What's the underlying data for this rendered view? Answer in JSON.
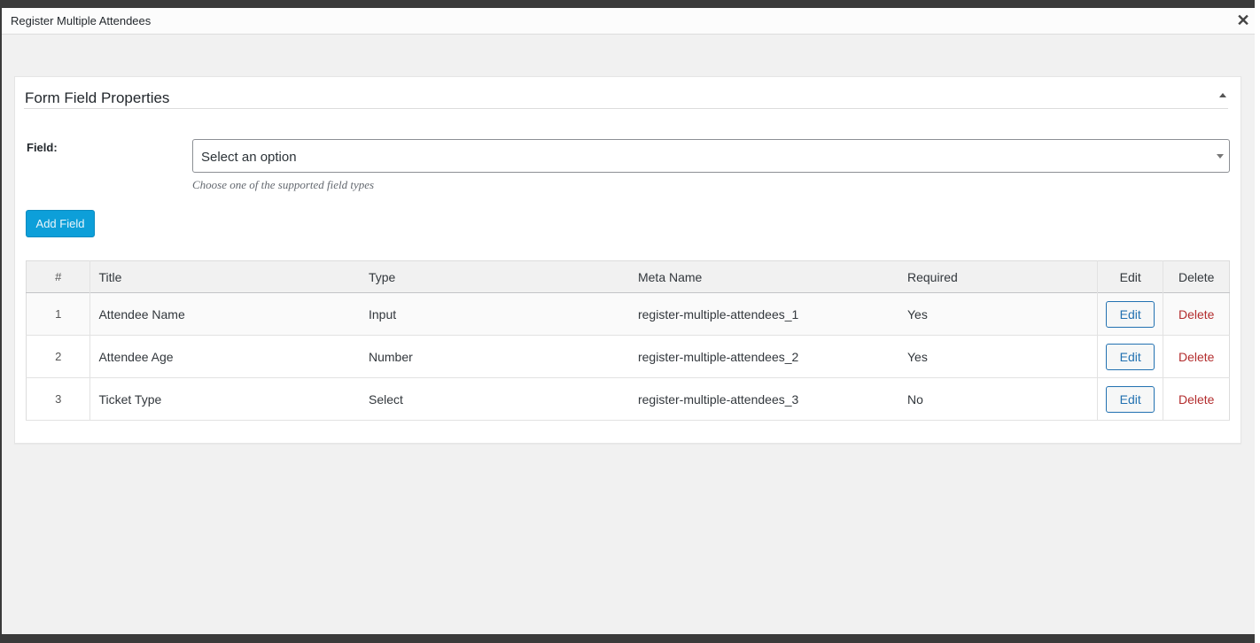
{
  "modal": {
    "title": "Register Multiple Attendees",
    "close_icon": "close-icon"
  },
  "panel": {
    "title": "Form Field Properties",
    "toggle_icon": "triangle-up-icon"
  },
  "field_selector": {
    "label": "Field:",
    "selected": "Select an option",
    "help": "Choose one of the supported field types"
  },
  "add_button": {
    "label": "Add Field"
  },
  "table": {
    "headers": {
      "num": "#",
      "title": "Title",
      "type": "Type",
      "meta": "Meta Name",
      "required": "Required",
      "edit": "Edit",
      "delete": "Delete"
    },
    "rows": [
      {
        "num": "1",
        "title": "Attendee Name",
        "type": "Input",
        "meta": "register-multiple-attendees_1",
        "required": "Yes",
        "edit": "Edit",
        "delete": "Delete"
      },
      {
        "num": "2",
        "title": "Attendee Age",
        "type": "Number",
        "meta": "register-multiple-attendees_2",
        "required": "Yes",
        "edit": "Edit",
        "delete": "Delete"
      },
      {
        "num": "3",
        "title": "Ticket Type",
        "type": "Select",
        "meta": "register-multiple-attendees_3",
        "required": "No",
        "edit": "Edit",
        "delete": "Delete"
      }
    ]
  },
  "colors": {
    "primary_button": "#0d9fd9",
    "link": "#2271b1",
    "delete": "#b32d2e"
  }
}
